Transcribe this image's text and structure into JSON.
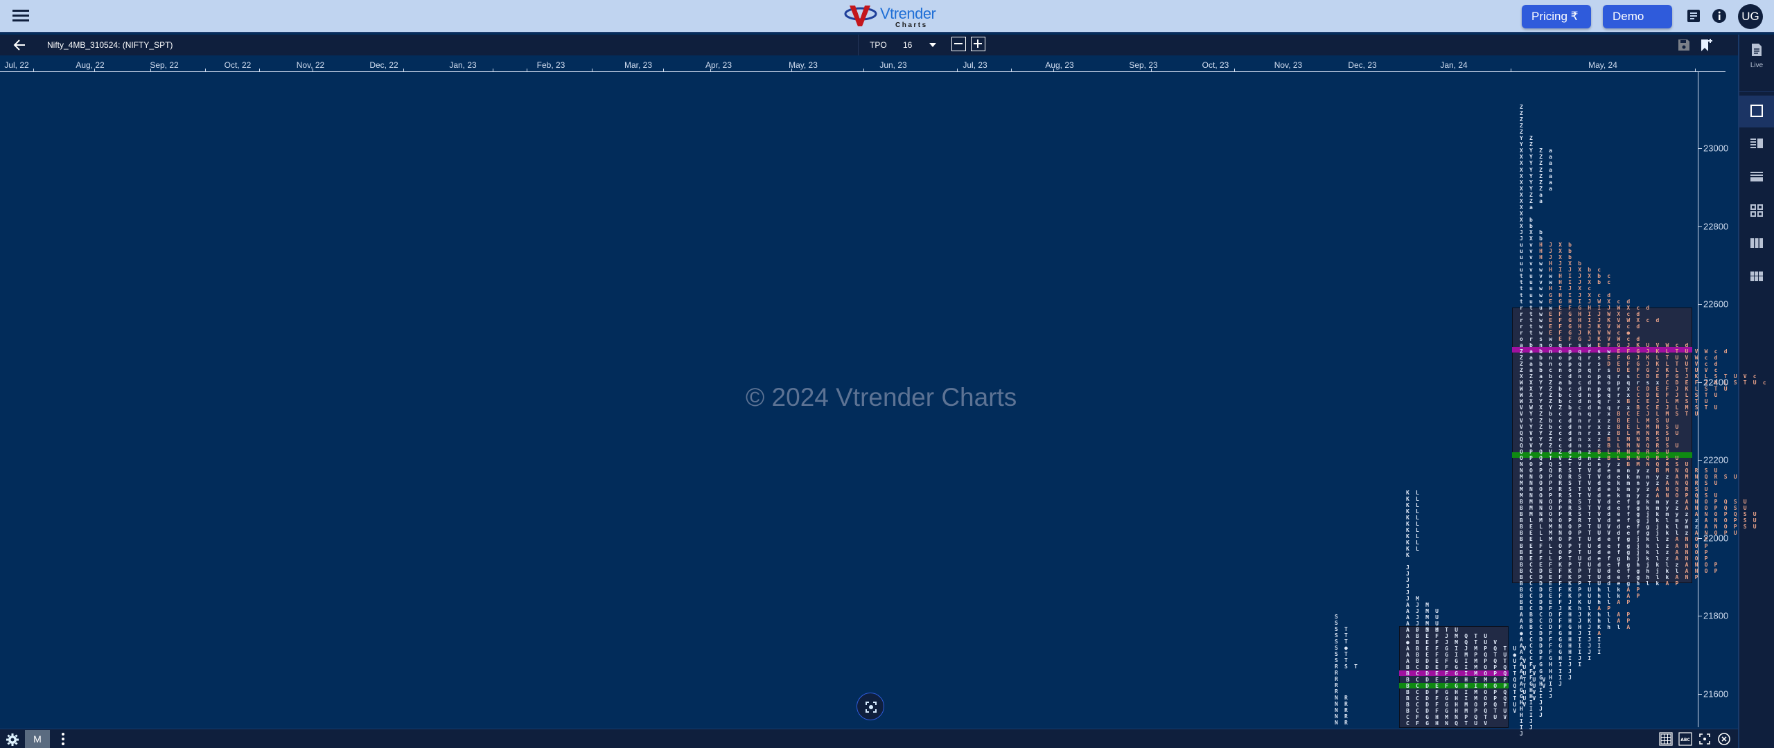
{
  "header": {
    "logo_main": "Vtrender",
    "logo_sub": "Charts",
    "pricing_label": "Pricing ₹",
    "demo_label": "Demo",
    "avatar_initials": "UG"
  },
  "toolbar": {
    "symbol": "Nifty_4MB_310524: (NIFTY_SPT)",
    "chart_type": "TPO",
    "tpo_size": "16"
  },
  "right_sidebar": {
    "live_label": "Live",
    "tools": [
      "single-profile",
      "split-profile",
      "horizontal-profile",
      "grid-profile",
      "column-profile",
      "matrix-profile"
    ]
  },
  "bottom_bar": {
    "mode_label": "M"
  },
  "watermark": "© 2024 Vtrender Charts",
  "x_axis": {
    "labels": [
      "Jul, 22",
      "Aug, 22",
      "Sep, 22",
      "Oct, 22",
      "Nov, 22",
      "Dec, 22",
      "Jan, 23",
      "Feb, 23",
      "Mar, 23",
      "Apr, 23",
      "May, 23",
      "Jun, 23",
      "Jul, 23",
      "Aug, 23",
      "Sep, 23",
      "Oct, 23",
      "Nov, 23",
      "Dec, 23",
      "Jan, 24",
      "May, 24"
    ]
  },
  "y_axis": {
    "labels": [
      "23000",
      "22800",
      "22600",
      "22400",
      "22200",
      "22000",
      "21800",
      "21600"
    ]
  },
  "profiles": {
    "small_left": [
      "S",
      "S",
      "S T",
      "S T",
      "S T",
      "S ●",
      "S T",
      "S T",
      "R S T",
      "R",
      "R",
      "R",
      "R",
      "N R",
      "N R",
      "N R",
      "N R",
      "N R"
    ],
    "mid_top": [
      "K L",
      "K L",
      "K L",
      "K L",
      "K L",
      "K L",
      "K L",
      "K L",
      "K L",
      "K L",
      "K",
      "",
      "J",
      "J",
      "J",
      "J",
      "J",
      "J M",
      "A J M",
      "A J M U",
      "A J M U",
      "A J M U",
      "A J M U"
    ],
    "mid_va": [
      "A F J M T U",
      "A B E F J M Q T U",
      "● B E F J M Q T U V",
      "A B E F G I J M P Q T U V",
      "A B E F G I M P Q T U ●",
      "A B D E F G I M P Q T U V",
      "B C D E F G I M O P Q T U V",
      "B C D E F G I M O P Q T U V",
      "B C D E F G H I M O P Q T U V",
      "B C D E F G H I M O P Q T U V",
      "B C D F G H I M O P Q T U V",
      "B C D F G H I M O P Q T U V",
      "B C D F G H M O P Q T U V",
      "B C D F G H M P Q T U V",
      "C F G H M N P Q T U V",
      "C F G H N Q T U V"
    ],
    "main": [
      {
        "w": "Z",
        "o": ""
      },
      {
        "w": "Z",
        "o": ""
      },
      {
        "w": "Z",
        "o": ""
      },
      {
        "w": "Z",
        "o": ""
      },
      {
        "w": "Z",
        "o": ""
      },
      {
        "w": "Y Z",
        "o": ""
      },
      {
        "w": "Y Z",
        "o": ""
      },
      {
        "w": "X Y Z a",
        "o": ""
      },
      {
        "w": "X Y Z a",
        "o": ""
      },
      {
        "w": "X Y Z a",
        "o": ""
      },
      {
        "w": "X Y Z a",
        "o": ""
      },
      {
        "w": "X Y Z a",
        "o": ""
      },
      {
        "w": "X Y Z a",
        "o": ""
      },
      {
        "w": "X Y Z a",
        "o": ""
      },
      {
        "w": "X Z a",
        "o": ""
      },
      {
        "w": "X Z a",
        "o": ""
      },
      {
        "w": "X a",
        "o": ""
      },
      {
        "w": "X",
        "o": ""
      },
      {
        "w": "X b",
        "o": ""
      },
      {
        "w": "X b",
        "o": ""
      },
      {
        "w": "J X b",
        "o": ""
      },
      {
        "w": "J X b",
        "o": ""
      },
      {
        "w": "u v ",
        "o": "H J X b"
      },
      {
        "w": "u v ",
        "o": "H J X b"
      },
      {
        "w": "u v ",
        "o": "H J X b"
      },
      {
        "w": "u v w ",
        "o": "H J X b"
      },
      {
        "w": "u v w ",
        "o": "H I J X b c"
      },
      {
        "w": "t u v w ",
        "o": "H I J X b c"
      },
      {
        "w": "t u v w ",
        "o": "H I J X b c"
      },
      {
        "w": "t u w ",
        "o": "H I J X c"
      },
      {
        "w": "t u w ",
        "o": "G H I J X c d"
      },
      {
        "w": "t u w ",
        "o": "E G H I J W X c d"
      },
      {
        "w": "r t u w ",
        "o": "E F G H I J W X c d"
      },
      {
        "w": "r t w ",
        "o": "E F G H I J W X c d"
      },
      {
        "w": "r t w ",
        "o": "E F G H I J K V W X c d"
      },
      {
        "w": "r t w ",
        "o": "E F G H J K V W c d"
      },
      {
        "w": "r t w ",
        "o": "E F G J K V W c ●"
      },
      {
        "w": "o r s w ",
        "o": "E F G J K V W c d"
      },
      {
        "w": "a b n o q r s w ",
        "o": "E F G J K U V W c d"
      },
      {
        "w": "Z a b n o p q r s w ",
        "o": "E F G J K L T U V W c d"
      },
      {
        "w": "Z a b n o p q r s ",
        "o": "E F G J K L T U V W c d",
        "poc": true
      },
      {
        "w": "Z a b n o p q r s ",
        "o": "D E F G J K L T U V c d"
      },
      {
        "w": "Z a b c n o p q r s ",
        "o": "D E F G J K L T U V c"
      },
      {
        "w": "X Z a b c d n o p q r s ",
        "o": "C D E F G J K L S T U V c"
      },
      {
        "w": "W X Y Z a b c d n o p q r s x ",
        "o": "C D E F J K L S T U c"
      },
      {
        "w": "W X Y Z b c d n p q r x ",
        "o": "C D E F J K L S T U"
      },
      {
        "w": "W X Y Z b c d n p q r x ",
        "o": "C D E F J L S T U"
      },
      {
        "w": "W X Y Z b c d n q r x ",
        "o": "B C E J L M S T U"
      },
      {
        "w": "V W X Y Z b c d n q r x ",
        "o": "B C E J L M S T U"
      },
      {
        "w": "V Y Z b c d n q r x ",
        "o": "B C E J L M S T U"
      },
      {
        "w": "V Y Z b c d n r x z ",
        "o": "B E L M S U"
      },
      {
        "w": "V Y Z b c d n r x z ",
        "o": "B E L M N S U"
      },
      {
        "w": "Q V Y Z c d n r x z ",
        "o": "B L M N R S U"
      },
      {
        "w": "Q V Y Z c d n x z ",
        "o": "B L M N R S U"
      },
      {
        "w": "Q V Y Z c d n x z ",
        "o": "B L M N Q R S U"
      },
      {
        "w": "O P Q V Z d n z ",
        "o": "B L M N Q R S U"
      },
      {
        "w": "O P Q T V Z d n z ",
        "o": "B L M N Q R S U"
      },
      {
        "w": "N O P Q S T V d n y z ",
        "o": "B M N Q R S U",
        "vwap": true
      },
      {
        "w": "N O P Q R S T V d e m n y z ",
        "o": "B M N Q R S U"
      },
      {
        "w": "M N O P Q R S T V d e k m n y z ",
        "o": "A M N Q R S U"
      },
      {
        "w": "M N O P R S T V d e k m n y z ",
        "o": "A N Q R S U"
      },
      {
        "w": "M N O P R S T V d e k m y z ",
        "o": "A N Q R S U"
      },
      {
        "w": "M N O P R S T V d e k m y z ",
        "o": "A N O P Q S U"
      },
      {
        "w": "B M N O P R S T V d e f g k m y z ",
        "o": "A N O P Q S U"
      },
      {
        "w": "B M N O P R S T V d e f g k m y z ",
        "o": "A N O P Q S U"
      },
      {
        "w": "B M N O P R S T V d e f g j k m y z ",
        "o": "A N O P Q S U"
      },
      {
        "w": "B L M N O P R T V d e f g j k l m y z ",
        "o": "A N O P S U"
      },
      {
        "w": "B E L M N O P T U V d e f g j k l m z ",
        "o": "A N O P S U"
      },
      {
        "w": "B E L M N O P T U V d e f g j k l z ",
        "o": "A N O P U"
      },
      {
        "w": "B E L M O P T U d e f g j k l z ",
        "o": "A N O P"
      },
      {
        "w": "B E F L O P T U d e f g j k l z ",
        "o": "A N O P"
      },
      {
        "w": "B E F L O P T U d e f g j k l z ",
        "o": "A N O P"
      },
      {
        "w": "B E F L P T U d e f g h j k l z ",
        "o": "A N O P"
      },
      {
        "w": "B C E F K P T U d e f g h j k l z ",
        "o": "A N O P"
      },
      {
        "w": "B C D E F K P T U d e f g h j k l ",
        "o": "A N O P"
      },
      {
        "w": "B C D E F K P T U d e f g h l k ",
        "o": "A N P"
      },
      {
        "w": "B C D E F K P T U d e g h l k ",
        "o": "A P"
      },
      {
        "w": "B C D E F K P U h l k ",
        "o": "A P"
      },
      {
        "w": "B C D E F K P U h l k ",
        "o": "A P"
      },
      {
        "w": "B C D E F J K U h l ",
        "o": "A P"
      },
      {
        "w": "B C D F J K h l ",
        "o": "A P"
      },
      {
        "w": "A B C D F H J K h l ",
        "o": "A P"
      },
      {
        "w": "A B C D F H J K h l ",
        "o": "A P"
      },
      {
        "w": "A B C D F G H J K h l ",
        "o": "A"
      },
      {
        "w": "● C D F G H J I ",
        "o": "A"
      },
      {
        "w": "A C D F G H I J I",
        "o": ""
      },
      {
        "w": "A C D F G H I J I",
        "o": ""
      },
      {
        "w": "A C D F G H I J I",
        "o": ""
      },
      {
        "w": "A C F G H I J I",
        "o": ""
      },
      {
        "w": "A F G H I J I",
        "o": ""
      },
      {
        "w": "A F G H I J",
        "o": ""
      },
      {
        "w": "A F G H I J",
        "o": ""
      },
      {
        "w": "A G H I J",
        "o": ""
      },
      {
        "w": "G H I J",
        "o": ""
      },
      {
        "w": "G H I J",
        "o": ""
      },
      {
        "w": "H I J",
        "o": ""
      },
      {
        "w": "H I J",
        "o": ""
      },
      {
        "w": "H I J",
        "o": ""
      },
      {
        "w": "I J",
        "o": ""
      },
      {
        "w": "I J",
        "o": ""
      },
      {
        "w": "J",
        "o": ""
      }
    ]
  }
}
